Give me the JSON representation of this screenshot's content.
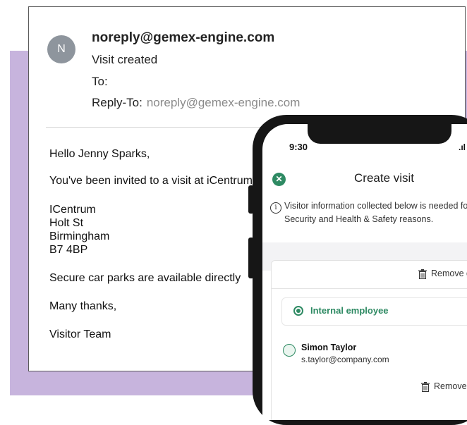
{
  "email": {
    "avatar_letter": "N",
    "sender": "noreply@gemex-engine.com",
    "subject": "Visit created",
    "to_label": "To:",
    "reply_to_label": "Reply-To:",
    "reply_to_address": "noreply@gemex-engine.com",
    "body": {
      "greeting": "Hello Jenny Sparks,",
      "invite_line": "You've been invited to a visit at iCentrum",
      "address_lines": [
        "ICentrum",
        "Holt St",
        "Birmingham",
        "B7 4BP"
      ],
      "parking_line": "Secure car parks are available directly",
      "thanks": "Many thanks,",
      "signoff": "Visitor Team"
    }
  },
  "phone": {
    "time": "9:30",
    "signal": ".ıl",
    "title": "Create visit",
    "info_text": "Visitor information collected below is needed for Security and Health & Safety reasons.",
    "remove_group_label": "Remove g",
    "internal_label": "Internal employee",
    "person_name": "Simon Taylor",
    "person_email": "s.taylor@company.com",
    "remove_visitor_label": "Remove v"
  },
  "colors": {
    "accent_green": "#2e8a63",
    "background_purple": "#c7b4dd",
    "avatar_grey": "#8e959d"
  }
}
